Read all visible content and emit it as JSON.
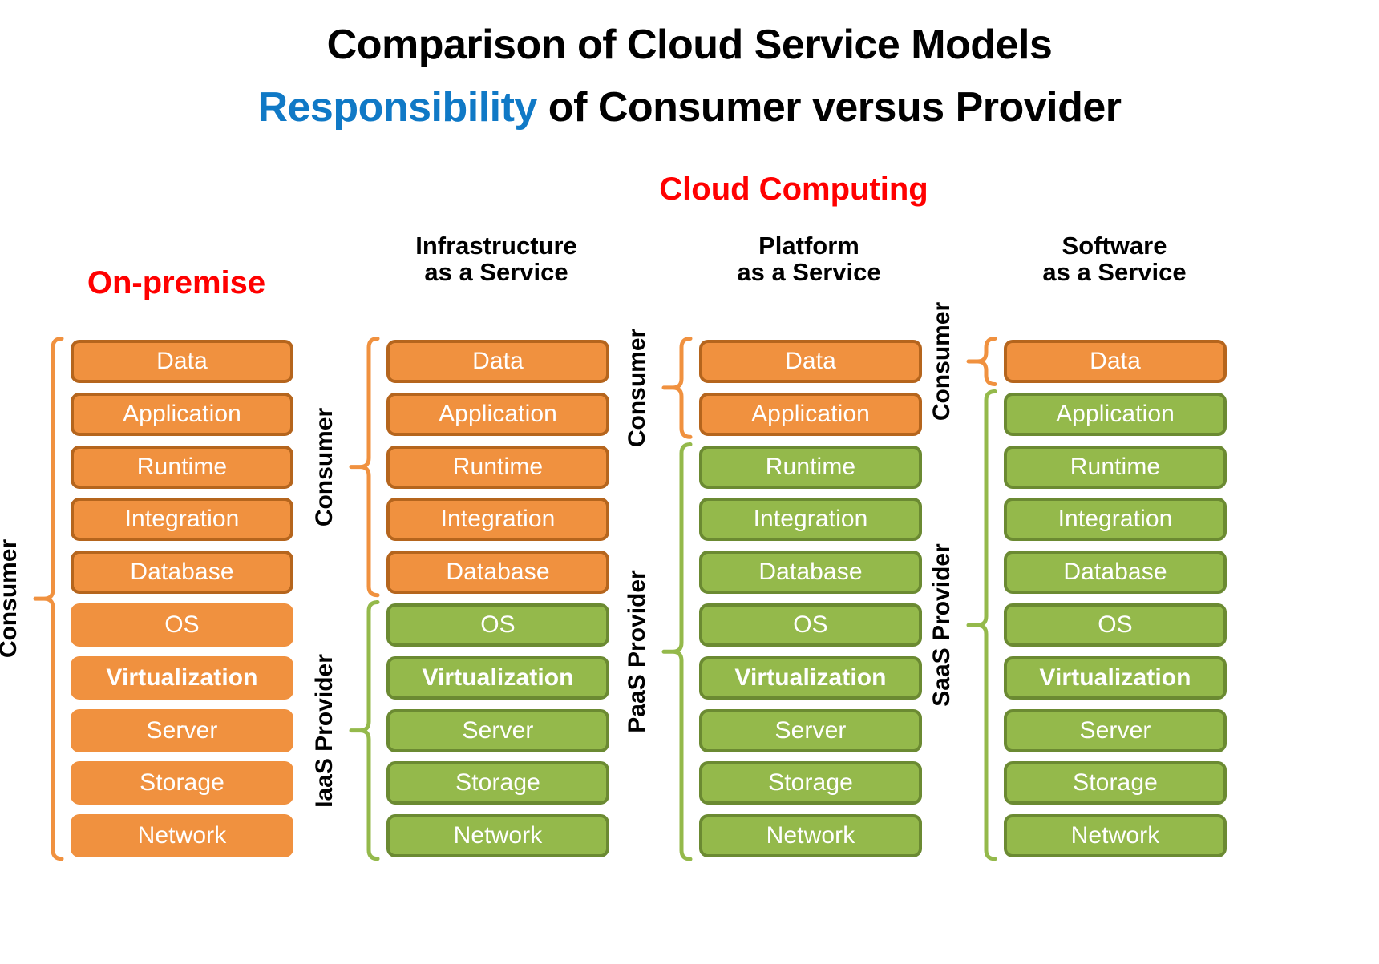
{
  "titles": {
    "line1": "Comparison of Cloud Service Models",
    "line2_highlight": "Responsibility",
    "line2_rest": " of Consumer versus Provider",
    "line2_full": "Responsibility of Consumer versus Provider",
    "cloud_computing": "Cloud Computing"
  },
  "colors": {
    "highlight_blue": "#1079C6",
    "red": "#FF0000",
    "orange_fill": "#F0913F",
    "orange_border": "#B5651D",
    "green_fill": "#94B94B",
    "green_border": "#6B8A32",
    "bracket_orange": "#F0913F",
    "bracket_green": "#94B94B",
    "text_black": "#000000",
    "box_text": "#FFFFFF"
  },
  "layers": [
    "Data",
    "Application",
    "Runtime",
    "Integration",
    "Database",
    "OS",
    "Virtualization",
    "Server",
    "Storage",
    "Network"
  ],
  "columns": [
    {
      "id": "on-premise",
      "header_lines": [
        "On-premise"
      ],
      "header_color": "red",
      "consumer_label": "Consumer",
      "provider_label": null,
      "orange_count": 10,
      "bordered_count": 5,
      "consumer_span": [
        0,
        10
      ],
      "provider_span": null
    },
    {
      "id": "iaas",
      "header_lines": [
        "Infrastructure",
        "as a Service"
      ],
      "header_color": "black",
      "consumer_label": "Consumer",
      "provider_label": "IaaS  Provider",
      "orange_count": 5,
      "bordered_count": 5,
      "consumer_span": [
        0,
        5
      ],
      "provider_span": [
        5,
        10
      ]
    },
    {
      "id": "paas",
      "header_lines": [
        "Platform",
        "as a Service"
      ],
      "header_color": "black",
      "consumer_label": "Consumer",
      "provider_label": "PaaS  Provider",
      "orange_count": 2,
      "bordered_count": 2,
      "consumer_span": [
        0,
        2
      ],
      "provider_span": [
        2,
        10
      ]
    },
    {
      "id": "saas",
      "header_lines": [
        "Software",
        "as a Service"
      ],
      "header_color": "black",
      "consumer_label": "Consumer",
      "provider_label": "SaaS  Provider",
      "orange_count": 1,
      "bordered_count": 1,
      "consumer_span": [
        0,
        1
      ],
      "provider_span": [
        1,
        10
      ]
    }
  ],
  "bold_layers": [
    "Virtualization"
  ]
}
